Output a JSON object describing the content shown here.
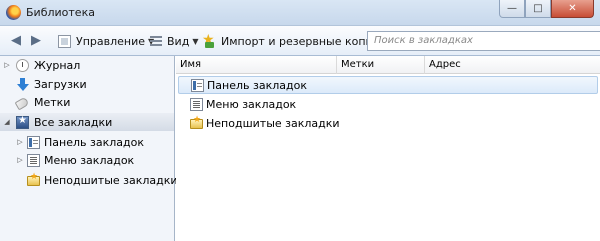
{
  "window": {
    "title": "Библиотека",
    "buttons": {
      "minimize": "—",
      "maximize": "□",
      "close": "✕"
    }
  },
  "toolbar": {
    "back_icon": "back-arrow-icon",
    "forward_icon": "forward-arrow-icon",
    "organize_label": "Управление",
    "views_label": "Вид",
    "import_label": "Импорт и резервные копии",
    "search_placeholder": "Поиск в закладках"
  },
  "sidebar": {
    "items": [
      {
        "label": "Журнал",
        "icon": "history-icon"
      },
      {
        "label": "Загрузки",
        "icon": "downloads-icon"
      },
      {
        "label": "Метки",
        "icon": "tags-icon"
      },
      {
        "label": "Все закладки",
        "icon": "all-bookmarks-icon",
        "selected": true
      },
      {
        "label": "Панель закладок",
        "icon": "bookmarks-toolbar-icon"
      },
      {
        "label": "Меню закладок",
        "icon": "bookmarks-menu-icon"
      },
      {
        "label": "Неподшитые закладки",
        "icon": "unsorted-bookmarks-icon"
      }
    ]
  },
  "main": {
    "columns": [
      "Имя",
      "Метки",
      "Адрес"
    ],
    "rows": [
      {
        "name": "Панель закладок",
        "icon": "bookmarks-toolbar-icon",
        "selected": true
      },
      {
        "name": "Меню закладок",
        "icon": "bookmarks-menu-icon"
      },
      {
        "name": "Неподшитые закладки",
        "icon": "unsorted-bookmarks-icon"
      }
    ]
  },
  "colors": {
    "titlebar": "#c7d8ec",
    "sidebar_bg": "#f2f5fa",
    "selection": "#dceafa"
  }
}
